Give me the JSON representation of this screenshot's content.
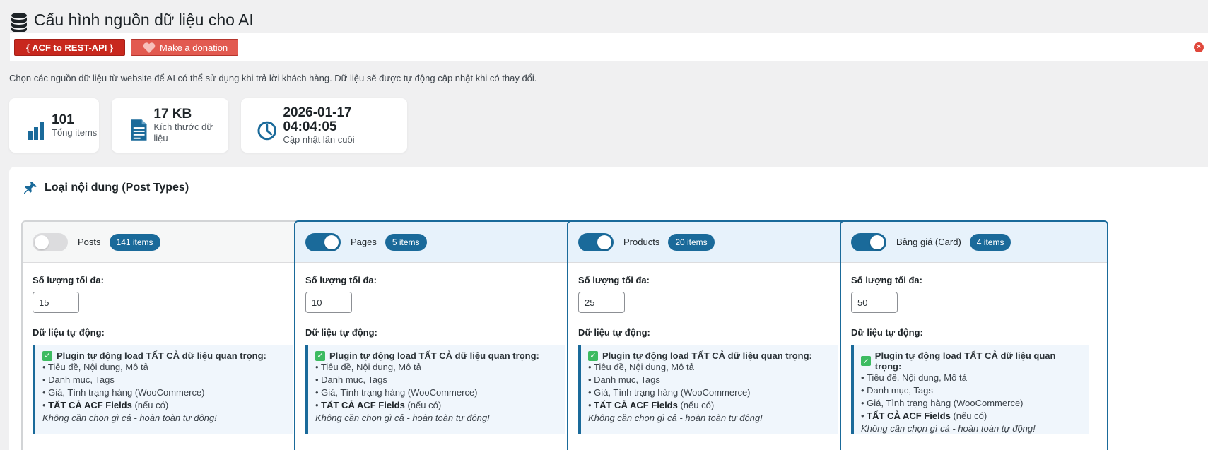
{
  "page": {
    "title": "Cấu hình nguồn dữ liệu cho AI",
    "description": "Chọn các nguồn dữ liệu từ website để AI có thể sử dụng khi trả lời khách hàng. Dữ liệu sẽ được tự động cập nhật khi có thay đổi."
  },
  "notice": {
    "acf_label": "{ ACF to REST-API }",
    "donate_label": "Make a donation",
    "close_label": "×"
  },
  "stats": [
    {
      "value": "101",
      "label": "Tổng items",
      "icon": "bar-chart-icon"
    },
    {
      "value": "17 KB",
      "label": "Kích thước dữ liệu",
      "icon": "document-icon"
    },
    {
      "value": "2026-01-17 04:04:05",
      "label": "Cập nhật lần cuối",
      "icon": "clock-icon"
    }
  ],
  "section": {
    "title": "Loại nội dung (Post Types)",
    "icon": "pin-icon"
  },
  "post_types": [
    {
      "name": "Posts",
      "badge": "141 items",
      "enabled": false,
      "qty": "15"
    },
    {
      "name": "Pages",
      "badge": "5 items",
      "enabled": true,
      "qty": "10"
    },
    {
      "name": "Products",
      "badge": "20 items",
      "enabled": true,
      "qty": "25"
    },
    {
      "name": "Bảng giá (Card)",
      "badge": "4 items",
      "enabled": true,
      "qty": "50"
    }
  ],
  "card_labels": {
    "max_qty": "Số lượng tối đa:",
    "auto_data": "Dữ liệu tự động:",
    "auto_head": "Plugin tự động load TẤT CẢ dữ liệu quan trọng:",
    "line1": "• Tiêu đề, Nội dung, Mô tả",
    "line2": "• Danh mục, Tags",
    "line3": "• Giá, Tình trạng hàng (WooCommerce)",
    "line4_prefix": "• ",
    "line4_bold": "TẤT CẢ ACF Fields",
    "line4_suffix": " (nếu có)",
    "note": "Không cần chọn gì cả - hoàn toàn tự động!"
  },
  "colors": {
    "accent": "#1a6a9a",
    "acf_red": "#c8281e",
    "donate_red": "#e25a50",
    "check_green": "#3dbb61"
  }
}
